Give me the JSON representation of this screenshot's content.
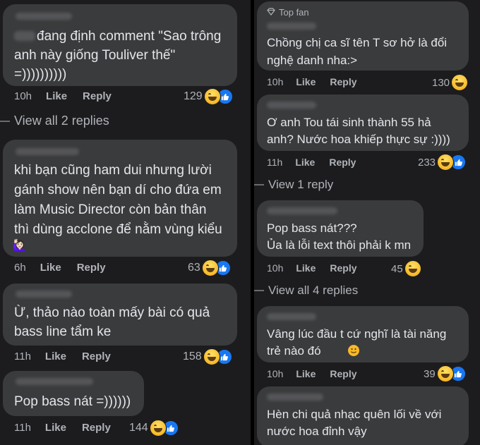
{
  "left": {
    "c1": {
      "text": "đang định comment \"Sao trông\nanh này giống Touliver thế\"\n=))))))))))",
      "time": "10h",
      "like": "Like",
      "reply": "Reply",
      "count": "129"
    },
    "view_all": "View all 2 replies",
    "c2": {
      "text": "khi bạn cũng ham dui nhưng lười\ngánh show nên bạn dí cho đứa em\nlàm Music Director còn bản thân\nthì dùng acclone để nằm vùng kiểu",
      "emoji": "🙋🏻‍♀️",
      "time": "6h",
      "like": "Like",
      "reply": "Reply",
      "count": "63"
    },
    "c3": {
      "text": "Ừ, thảo nào toàn mấy bài có quả\nbass line tẩm ke",
      "time": "11h",
      "like": "Like",
      "reply": "Reply",
      "count": "158"
    },
    "c4": {
      "text": "Pop bass nát =))))))",
      "time": "11h",
      "like": "Like",
      "reply": "Reply",
      "count": "144"
    }
  },
  "right": {
    "top_fan": "Top fan",
    "c1": {
      "text": "Chồng chị ca sĩ tên T sơ hở là đổi\nnghệ danh nha:>",
      "time": "10h",
      "like": "Like",
      "reply": "Reply",
      "count": "130"
    },
    "c2": {
      "text": "Ơ anh Tou tái sinh thành 55 hả\nanh? Nước hoa khiếp thực sự :))))",
      "time": "11h",
      "like": "Like",
      "reply": "Reply",
      "count": "233"
    },
    "view_1": "View 1 reply",
    "c3": {
      "text": "Pop bass nát???\nỦa là lỗi text thôi phải k mn",
      "time": "10h",
      "like": "Like",
      "reply": "Reply",
      "count": "45"
    },
    "view_all": "View all 4 replies",
    "c4": {
      "text": "Vâng lúc đầu t cứ nghĩ là tài năng\ntrẻ nào đó",
      "time": "10h",
      "like": "Like",
      "reply": "Reply",
      "count": "39"
    },
    "c5": {
      "text": "Hèn chi quả nhạc quên lối về với\nnước hoa đỉnh vậy"
    }
  },
  "colors": {
    "bubble": "#3a3b3c",
    "background": "#1c1c1e",
    "like_blue": "#1877f2",
    "haha_yellow": "#f7b928"
  },
  "icons": {
    "haha": "haha-reaction-icon",
    "like": "like-reaction-icon",
    "top_fan": "diamond-icon"
  }
}
